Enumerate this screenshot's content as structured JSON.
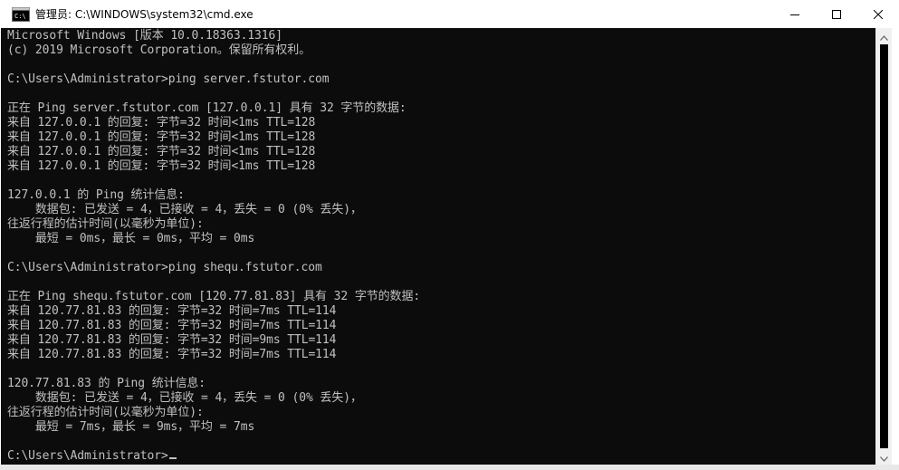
{
  "window": {
    "title": "管理员: C:\\WINDOWS\\system32\\cmd.exe",
    "app_icon": "cmd-icon",
    "controls": [
      "minimize-icon",
      "maximize-icon",
      "close-icon"
    ]
  },
  "console": {
    "background": "#0c0c0c",
    "foreground": "#c0c0c0",
    "lines": [
      "Microsoft Windows [版本 10.0.18363.1316]",
      "(c) 2019 Microsoft Corporation。保留所有权利。",
      "",
      "C:\\Users\\Administrator>ping server.fstutor.com",
      "",
      "正在 Ping server.fstutor.com [127.0.0.1] 具有 32 字节的数据:",
      "来自 127.0.0.1 的回复: 字节=32 时间<1ms TTL=128",
      "来自 127.0.0.1 的回复: 字节=32 时间<1ms TTL=128",
      "来自 127.0.0.1 的回复: 字节=32 时间<1ms TTL=128",
      "来自 127.0.0.1 的回复: 字节=32 时间<1ms TTL=128",
      "",
      "127.0.0.1 的 Ping 统计信息:",
      "    数据包: 已发送 = 4，已接收 = 4，丢失 = 0 (0% 丢失)，",
      "往返行程的估计时间(以毫秒为单位):",
      "    最短 = 0ms，最长 = 0ms，平均 = 0ms",
      "",
      "C:\\Users\\Administrator>ping shequ.fstutor.com",
      "",
      "正在 Ping shequ.fstutor.com [120.77.81.83] 具有 32 字节的数据:",
      "来自 120.77.81.83 的回复: 字节=32 时间=7ms TTL=114",
      "来自 120.77.81.83 的回复: 字节=32 时间=7ms TTL=114",
      "来自 120.77.81.83 的回复: 字节=32 时间=9ms TTL=114",
      "来自 120.77.81.83 的回复: 字节=32 时间=7ms TTL=114",
      "",
      "120.77.81.83 的 Ping 统计信息:",
      "    数据包: 已发送 = 4，已接收 = 4，丢失 = 0 (0% 丢失)，",
      "往返行程的估计时间(以毫秒为单位):",
      "    最短 = 7ms，最长 = 9ms，平均 = 7ms",
      "",
      "C:\\Users\\Administrator>"
    ]
  },
  "scrollbar": {
    "up_icon": "chevron-up-icon",
    "down_icon": "chevron-down-icon"
  }
}
